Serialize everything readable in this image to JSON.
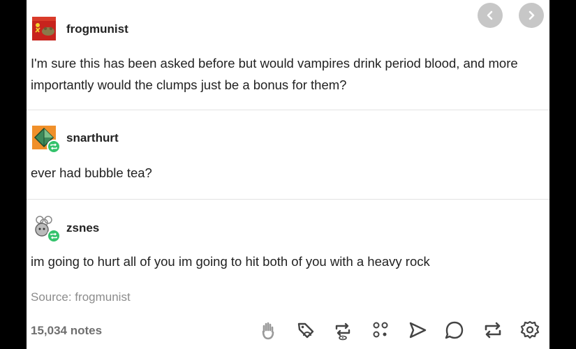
{
  "posts": [
    {
      "username": "frogmunist",
      "text": "I'm sure this has been asked before but would vampires drink period blood, and more importantly would the clumps just be a bonus for them?"
    },
    {
      "username": "snarthurt",
      "text": "ever had bubble tea?"
    },
    {
      "username": "zsnes",
      "text": "im going to hurt all of you im going to hit both of you with a heavy rock"
    }
  ],
  "source": "Source: frogmunist",
  "notes": "15,034 notes",
  "icons": {
    "prev": "chevron-left-icon",
    "next": "chevron-right-icon",
    "actions": [
      "hand-icon",
      "tag-icon",
      "reblog-view-icon",
      "community-icon",
      "share-icon",
      "reply-icon",
      "reblog-icon",
      "settings-icon"
    ]
  },
  "colors": {
    "reblog_green": "#34c26c",
    "nav_gray": "#c7c7c7",
    "text": "#222222",
    "muted": "#8c8c8c"
  }
}
